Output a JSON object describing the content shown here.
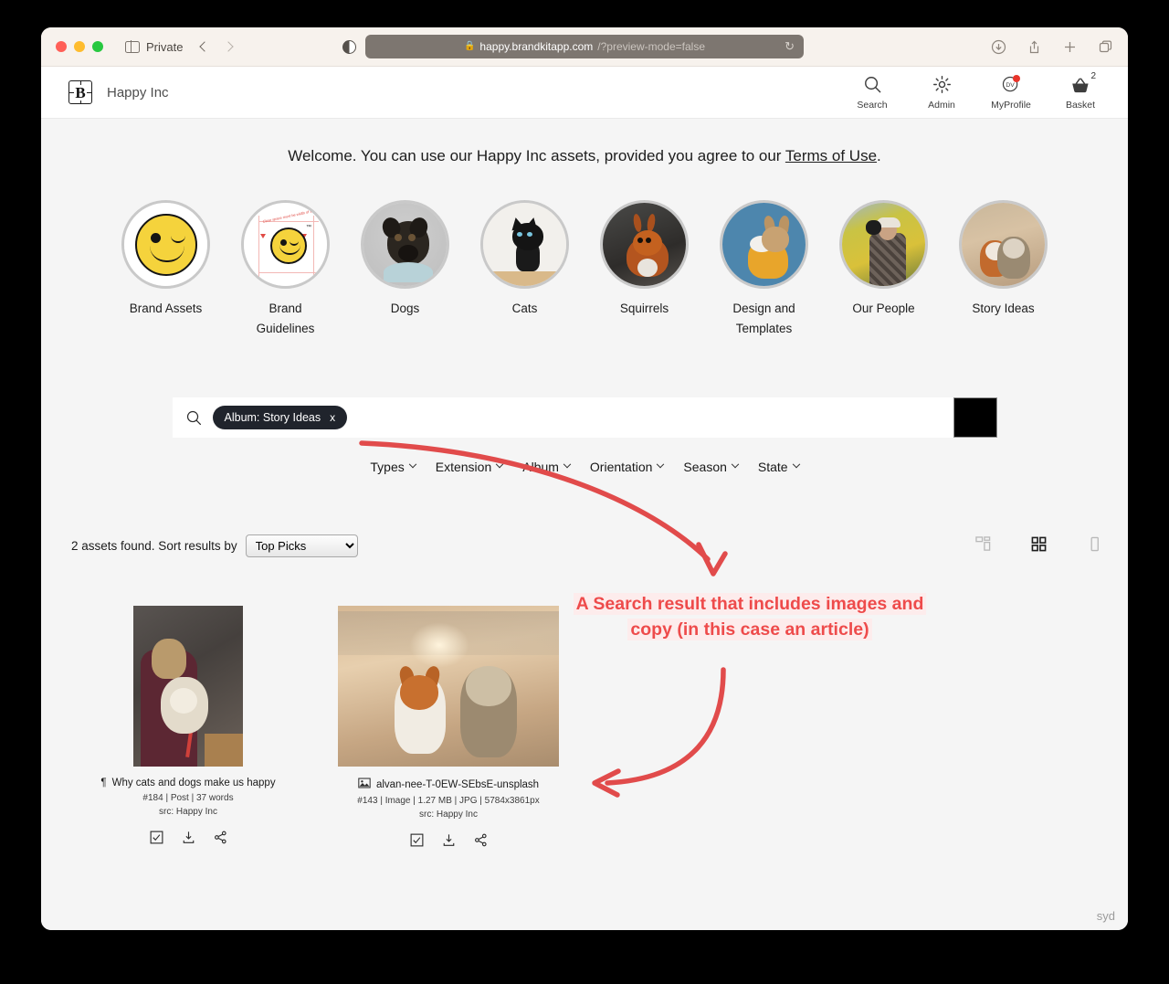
{
  "browser": {
    "profile_label": "Private",
    "url_host": "happy.brandkitapp.com",
    "url_path": "/?preview-mode=false",
    "lock_glyph": "🔒",
    "reload_glyph": "↻",
    "back_icon": "chevron-left-icon",
    "forward_icon": "chevron-right-icon",
    "toolbar_icons": [
      "downloads-icon",
      "share-icon",
      "new-tab-icon",
      "tab-overview-icon"
    ]
  },
  "header": {
    "logo_letter": "B",
    "brand_name": "Happy Inc",
    "nav": [
      {
        "label": "Search",
        "icon": "search-icon"
      },
      {
        "label": "Admin",
        "icon": "gear-icon"
      },
      {
        "label": "MyProfile",
        "icon": "avatar-icon",
        "avatar_initials": "DV",
        "has_notification_dot": true
      },
      {
        "label": "Basket",
        "icon": "basket-icon",
        "count": "2"
      }
    ]
  },
  "welcome": {
    "prefix": "Welcome. You can use our Happy Inc assets, provided you agree to our ",
    "link": "Terms of Use",
    "suffix": "."
  },
  "categories": [
    {
      "label": "Brand Assets",
      "art": "smiley"
    },
    {
      "label": "Brand Guidelines",
      "art": "guidelines"
    },
    {
      "label": "Dogs",
      "art": "pug"
    },
    {
      "label": "Cats",
      "art": "kitten"
    },
    {
      "label": "Squirrels",
      "art": "squirrel"
    },
    {
      "label": "Design and Templates",
      "art": "frenchie"
    },
    {
      "label": "Our People",
      "art": "people"
    },
    {
      "label": "Story Ideas",
      "art": "story"
    }
  ],
  "search": {
    "icon": "search-icon",
    "chip_label": "Album: Story Ideas",
    "chip_remove": "x",
    "placeholder": "",
    "value": "",
    "submit_label": "",
    "submit_color": "#000000"
  },
  "filters": [
    {
      "label": "Types"
    },
    {
      "label": "Extension"
    },
    {
      "label": "Album"
    },
    {
      "label": "Orientation"
    },
    {
      "label": "Season"
    },
    {
      "label": "State"
    }
  ],
  "results": {
    "count_text": "2 assets found. Sort results by",
    "sort_selected": "Top Picks",
    "sort_options": [
      "Top Picks"
    ],
    "view_modes": [
      {
        "name": "masonry-view-icon",
        "active": false
      },
      {
        "name": "grid-view-icon",
        "active": true
      },
      {
        "name": "list-view-icon",
        "active": false
      }
    ]
  },
  "assets": [
    {
      "type_icon": "pilcrow-icon",
      "title": "Why cats and dogs make us happy",
      "meta": "#184 | Post | 37 words",
      "source": "src: Happy Inc",
      "art": "article",
      "actions": [
        "select-checkbox-icon",
        "download-icon",
        "share-icon"
      ]
    },
    {
      "type_icon": "image-icon",
      "title": "alvan-nee-T-0EW-SEbsE-unsplash",
      "meta": "#143 | Image | 1.27 MB | JPG | 5784x3861px",
      "source": "src: Happy Inc",
      "art": "photo",
      "actions": [
        "select-checkbox-icon",
        "download-icon",
        "share-icon"
      ]
    }
  ],
  "annotation": {
    "line1": "A Search result that includes images and",
    "line2": "copy (in this case an article)",
    "color": "#ee4b4b",
    "highlight": "#fdecec"
  },
  "watermark": "syd"
}
